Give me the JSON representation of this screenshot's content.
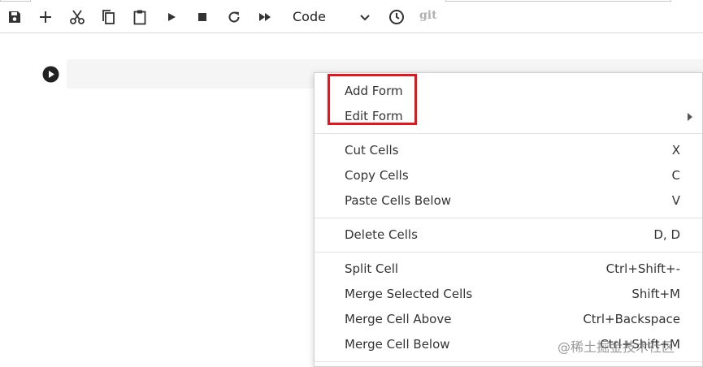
{
  "toolbar": {
    "cell_type": "Code",
    "git_label": "git"
  },
  "context_menu": {
    "form_items": [
      {
        "label": "Add Form",
        "shortcut": ""
      },
      {
        "label": "Edit Form",
        "shortcut": ""
      }
    ],
    "clipboard_items": [
      {
        "label": "Cut Cells",
        "shortcut": "X"
      },
      {
        "label": "Copy Cells",
        "shortcut": "C"
      },
      {
        "label": "Paste Cells Below",
        "shortcut": "V"
      }
    ],
    "delete_items": [
      {
        "label": "Delete Cells",
        "shortcut": "D, D"
      }
    ],
    "edit_items": [
      {
        "label": "Split Cell",
        "shortcut": "Ctrl+Shift+-"
      },
      {
        "label": "Merge Selected Cells",
        "shortcut": "Shift+M"
      },
      {
        "label": "Merge Cell Above",
        "shortcut": "Ctrl+Backspace"
      },
      {
        "label": "Merge Cell Below",
        "shortcut": "Ctrl+Shift+M"
      }
    ]
  },
  "watermark": "@稀土掘金技术社区",
  "icons": {
    "save": "save-icon",
    "add": "plus-icon",
    "cut": "scissors-icon",
    "copy": "copy-icon",
    "paste": "clipboard-icon",
    "run": "play-icon",
    "stop": "stop-icon",
    "restart": "restart-icon",
    "run_all": "fast-forward-icon",
    "history": "clock-icon"
  },
  "colors": {
    "highlight": "#e8141c",
    "cell_background": "#f5f5f5",
    "icon": "#333333"
  }
}
